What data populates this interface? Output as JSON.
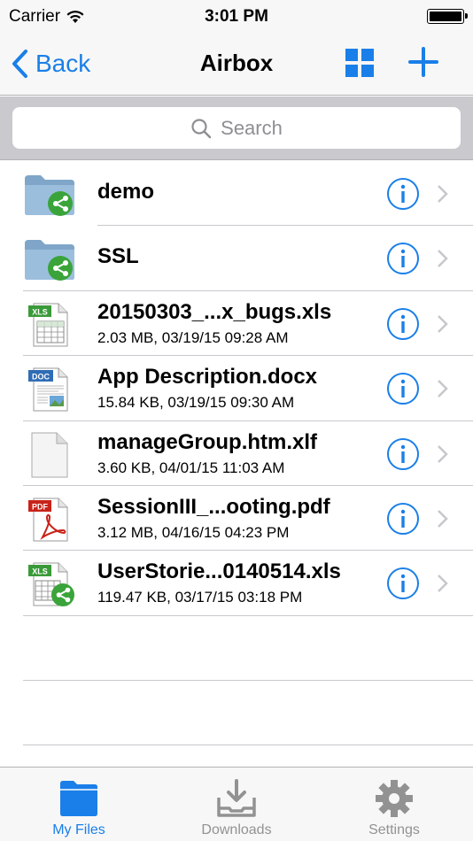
{
  "status_bar": {
    "carrier": "Carrier",
    "time": "3:01 PM"
  },
  "nav": {
    "back_label": "Back",
    "title": "Airbox"
  },
  "search": {
    "placeholder": "Search"
  },
  "files": [
    {
      "name": "demo",
      "meta": "",
      "icon": "shared-folder-icon"
    },
    {
      "name": "SSL",
      "meta": "",
      "icon": "shared-folder-icon"
    },
    {
      "name": "20150303_...x_bugs.xls",
      "meta": "2.03 MB, 03/19/15 09:28 AM",
      "icon": "xls-file-icon"
    },
    {
      "name": "App Description.docx",
      "meta": "15.84 KB, 03/19/15 09:30 AM",
      "icon": "doc-file-icon"
    },
    {
      "name": "manageGroup.htm.xlf",
      "meta": "3.60 KB, 04/01/15 11:03 AM",
      "icon": "blank-file-icon"
    },
    {
      "name": "SessionIII_...ooting.pdf",
      "meta": "3.12 MB, 04/16/15 04:23 PM",
      "icon": "pdf-file-icon"
    },
    {
      "name": "UserStorie...0140514.xls",
      "meta": "119.47 KB, 03/17/15 03:18 PM",
      "icon": "shared-xls-file-icon"
    }
  ],
  "tabs": [
    {
      "label": "My Files",
      "icon": "folder-icon",
      "active": true
    },
    {
      "label": "Downloads",
      "icon": "download-tray-icon",
      "active": false
    },
    {
      "label": "Settings",
      "icon": "gear-icon",
      "active": false
    }
  ],
  "colors": {
    "accent": "#1a7fe8",
    "inactive": "#929292",
    "share_badge": "#3aa43a"
  }
}
